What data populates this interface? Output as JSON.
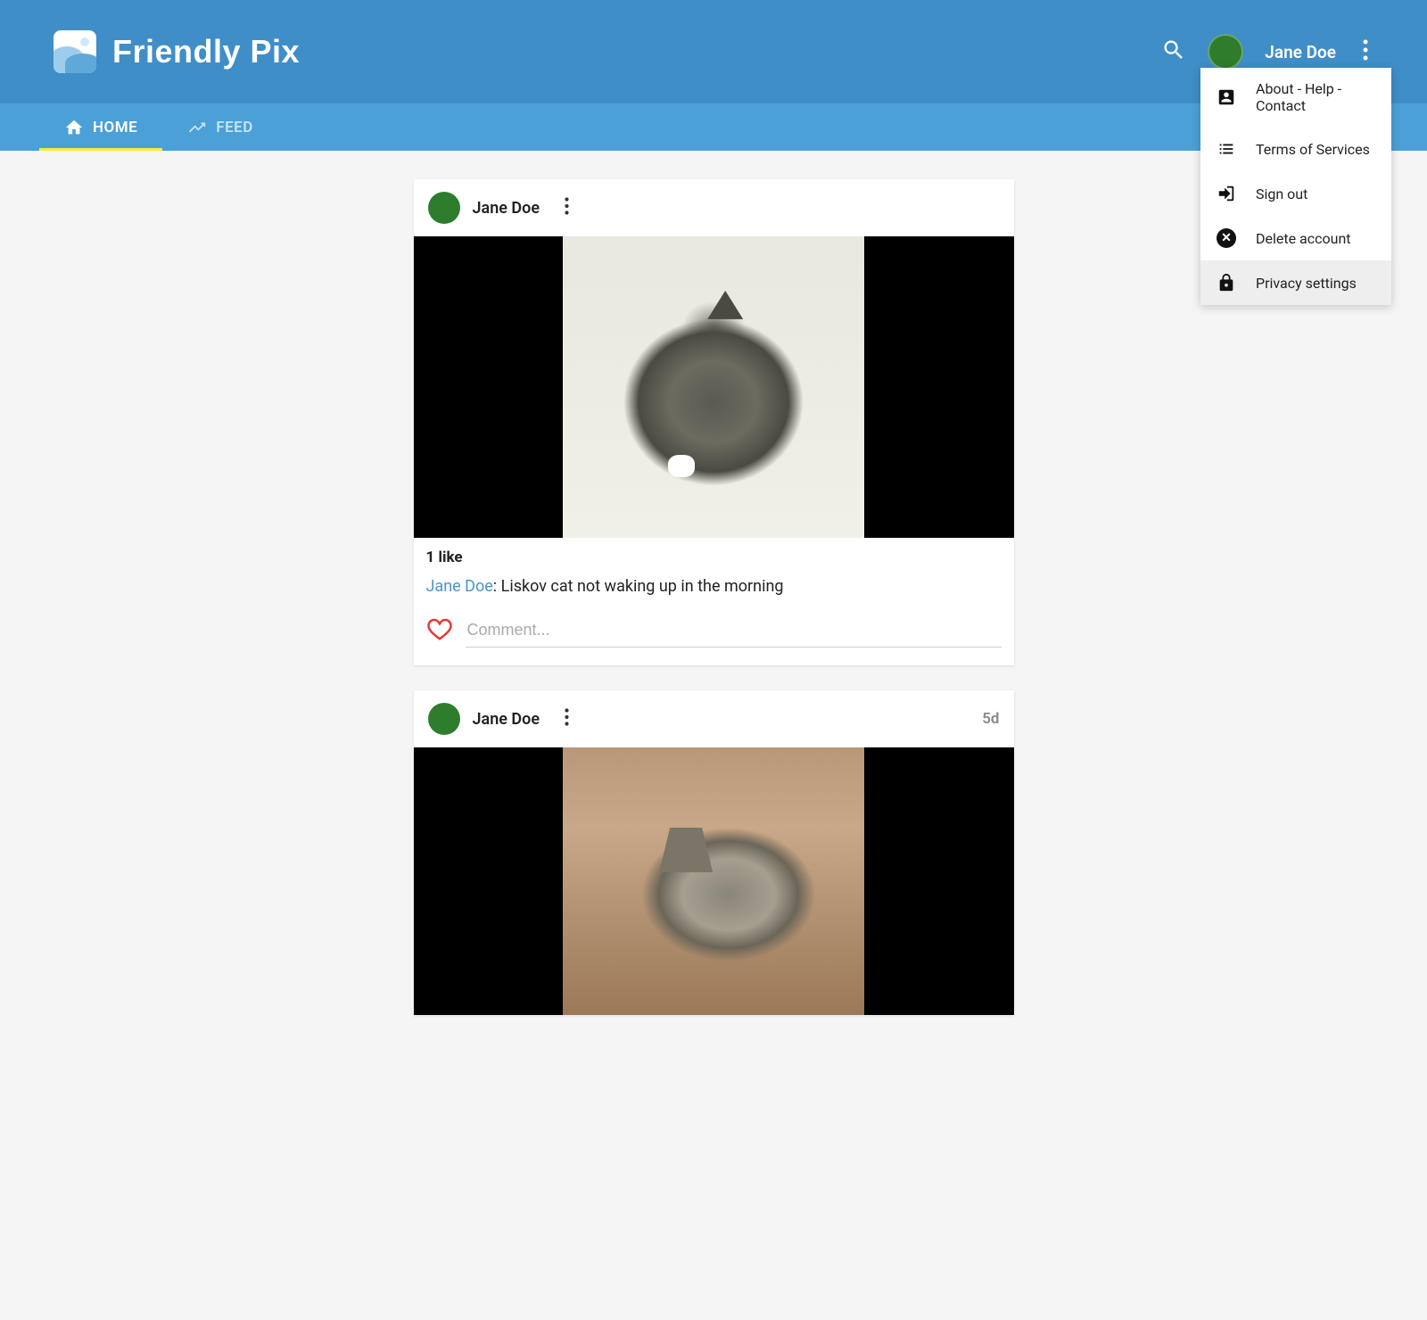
{
  "app": {
    "title": "Friendly Pix"
  },
  "header": {
    "user_name": "Jane Doe",
    "avatar_color": "#2d7d2d"
  },
  "tabs": {
    "home": "HOME",
    "feed": "FEED"
  },
  "menu": {
    "about": "About - Help - Contact",
    "terms": "Terms of Services",
    "signout": "Sign out",
    "delete": "Delete account",
    "privacy": "Privacy settings"
  },
  "posts": [
    {
      "author": "Jane Doe",
      "time": "",
      "likes": "1 like",
      "caption_author": "Jane Doe",
      "caption_sep": ": ",
      "caption_text": "Liskov cat not waking up in the morning",
      "comment_placeholder": "Comment..."
    },
    {
      "author": "Jane Doe",
      "time": "5d"
    }
  ]
}
